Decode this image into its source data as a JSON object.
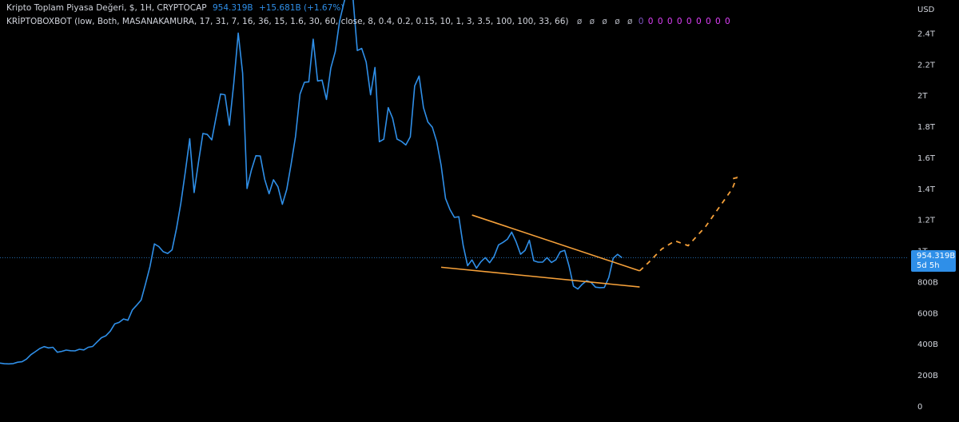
{
  "header": {
    "symbol_title": "Kripto Toplam Piyasa Değeri, $, 1H, CRYPTOCAP",
    "last_value": "954.319B",
    "change": "+15.681B (+1.67%)",
    "indicator_label": "KRİPTOBOXBOT (low, Both, MASANAKAMURA, 17, 31, 7, 16, 36, 15, 1.6, 30, 60, close, 8, 0.4, 0.2, 0.15, 10, 1, 3, 3.5, 100, 100, 33, 66)",
    "indicator_nulls": [
      "ø",
      "ø",
      "ø",
      "ø",
      "ø"
    ],
    "indicator_zeros": [
      "0",
      "0",
      "0",
      "0",
      "0",
      "0",
      "0",
      "0",
      "0",
      "0"
    ]
  },
  "price_badge": {
    "value": "954.319B",
    "countdown": "5d 5h"
  },
  "colors": {
    "series": "#2f8fe8",
    "trendline": "#f6a13a",
    "projection": "#f6a13a",
    "badge": "#2f8fe8",
    "nulls": "#b2b5be",
    "zero_blue": "#7e57c2",
    "zero_pink": "#e040fb"
  },
  "chart_data": {
    "type": "line",
    "currency_label": "USD",
    "y_ticks": [
      {
        "value": 0,
        "label": "0"
      },
      {
        "value": 200,
        "label": "200B"
      },
      {
        "value": 400,
        "label": "400B"
      },
      {
        "value": 600,
        "label": "600B"
      },
      {
        "value": 800,
        "label": "800B"
      },
      {
        "value": 1000,
        "label": "1T"
      },
      {
        "value": 1200,
        "label": "1.2T"
      },
      {
        "value": 1400,
        "label": "1.4T"
      },
      {
        "value": 1600,
        "label": "1.6T"
      },
      {
        "value": 1800,
        "label": "1.8T"
      },
      {
        "value": 2000,
        "label": "2T"
      },
      {
        "value": 2200,
        "label": "2.2T"
      },
      {
        "value": 2400,
        "label": "2.4T"
      }
    ],
    "ylim": [
      0,
      2600
    ],
    "grid": false,
    "last_value": 954.319,
    "series": [
      {
        "values": [
          276,
          272,
          271,
          273,
          282,
          285,
          302,
          330,
          350,
          370,
          382,
          374,
          378,
          346,
          352,
          360,
          356,
          355,
          365,
          361,
          378,
          383,
          412,
          440,
          452,
          482,
          528,
          538,
          560,
          552,
          618,
          649,
          682,
          788,
          898,
          1043,
          1026,
          993,
          982,
          1005,
          1141,
          1305,
          1504,
          1720,
          1374,
          1571,
          1754,
          1748,
          1713,
          1862,
          2008,
          2003,
          1807,
          2080,
          2400,
          2142,
          1400,
          1519,
          1611,
          1609,
          1459,
          1366,
          1456,
          1411,
          1298,
          1394,
          1557,
          1735,
          2007,
          2083,
          2086,
          2361,
          2092,
          2097,
          1973,
          2176,
          2280,
          2479,
          2600,
          2700,
          2632,
          2288,
          2301,
          2214,
          2003,
          2179,
          1701,
          1717,
          1920,
          1852,
          1718,
          1703,
          1680,
          1733,
          2060,
          2123,
          1920,
          1828,
          1794,
          1701,
          1548,
          1336,
          1265,
          1214,
          1218,
          1033,
          903,
          940,
          887,
          928,
          955,
          922,
          963,
          1037,
          1053,
          1073,
          1119,
          1057,
          977,
          1001,
          1067,
          935,
          926,
          926,
          955,
          924,
          941,
          992,
          1002,
          900,
          771,
          753,
          784,
          807,
          795,
          765,
          762,
          763,
          827,
          951,
          976,
          954
        ]
      }
    ],
    "trendlines": [
      {
        "from": [
          107,
          1229
        ],
        "to": [
          145,
          870
        ]
      },
      {
        "from": [
          100,
          893
        ],
        "to": [
          145,
          766
        ]
      }
    ],
    "projection": [
      [
        145,
        870
      ],
      [
        147,
        923
      ],
      [
        150,
        1010
      ],
      [
        153,
        1063
      ],
      [
        156,
        1032
      ],
      [
        160,
        1157
      ],
      [
        166,
        1398
      ],
      [
        167,
        1470
      ],
      [
        166,
        1462
      ]
    ]
  }
}
